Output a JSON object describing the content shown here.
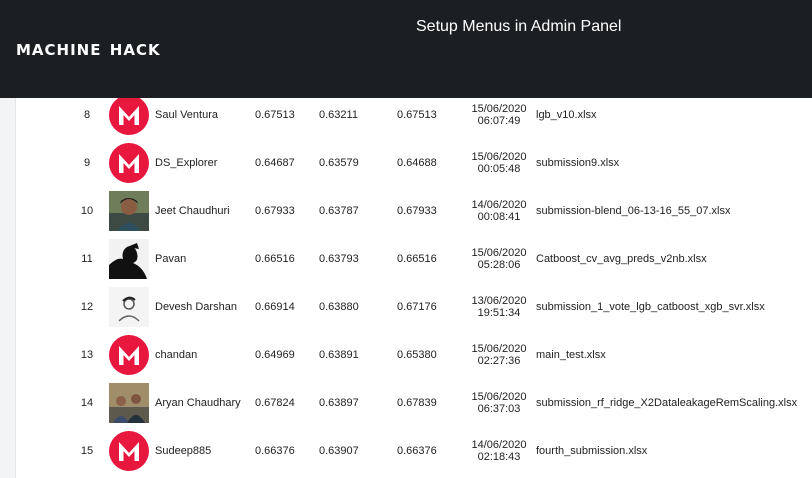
{
  "header": {
    "logo_text": "Machine Hack",
    "page_heading": "Setup Menus in Admin Panel"
  },
  "rows": [
    {
      "rank": "8",
      "avatar": "m-logo",
      "name": "Saul Ventura",
      "score1": "0.67513",
      "score2": "0.63211",
      "score3": "0.67513",
      "date": "15/06/2020",
      "time": "06:07:49",
      "file": "lgb_v10.xlsx"
    },
    {
      "rank": "9",
      "avatar": "m-logo",
      "name": "DS_Explorer",
      "score1": "0.64687",
      "score2": "0.63579",
      "score3": "0.64688",
      "date": "15/06/2020",
      "time": "00:05:48",
      "file": "submission9.xlsx"
    },
    {
      "rank": "10",
      "avatar": "photo-man-smiling",
      "name": "Jeet Chaudhuri",
      "score1": "0.67933",
      "score2": "0.63787",
      "score3": "0.67933",
      "date": "14/06/2020",
      "time": "00:08:41",
      "file": "submission-blend_06-13-16_55_07.xlsx"
    },
    {
      "rank": "11",
      "avatar": "photo-silhouette",
      "name": "Pavan",
      "score1": "0.66516",
      "score2": "0.63793",
      "score3": "0.66516",
      "date": "15/06/2020",
      "time": "05:28:06",
      "file": "Catboost_cv_avg_preds_v2nb.xlsx"
    },
    {
      "rank": "12",
      "avatar": "photo-sketch",
      "name": "Devesh Darshan",
      "score1": "0.66914",
      "score2": "0.63880",
      "score3": "0.67176",
      "date": "13/06/2020",
      "time": "19:51:34",
      "file": "submission_1_vote_lgb_catboost_xgb_svr.xlsx"
    },
    {
      "rank": "13",
      "avatar": "m-logo",
      "name": "chandan",
      "score1": "0.64969",
      "score2": "0.63891",
      "score3": "0.65380",
      "date": "15/06/2020",
      "time": "02:27:36",
      "file": "main_test.xlsx"
    },
    {
      "rank": "14",
      "avatar": "photo-group",
      "name": "Aryan Chaudhary",
      "score1": "0.67824",
      "score2": "0.63897",
      "score3": "0.67839",
      "date": "15/06/2020",
      "time": "06:37:03",
      "file": "submission_rf_ridge_X2DataleakageRemScaling.xlsx"
    },
    {
      "rank": "15",
      "avatar": "m-logo",
      "name": "Sudeep885",
      "score1": "0.66376",
      "score2": "0.63907",
      "score3": "0.66376",
      "date": "14/06/2020",
      "time": "02:18:43",
      "file": "fourth_submission.xlsx"
    }
  ]
}
